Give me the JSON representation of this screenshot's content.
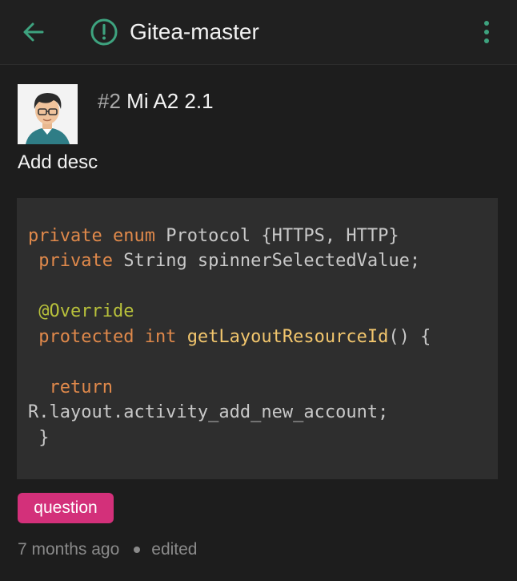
{
  "toolbar": {
    "title": "Gitea-master",
    "back_icon": "arrow-left-icon",
    "status_icon": "alert-circle-icon",
    "menu_icon": "more-vertical-icon",
    "accent_color": "#3ea37f"
  },
  "issue": {
    "number": "#2",
    "title": "Mi A2 2.1",
    "description": "Add desc",
    "avatar_icon": "user-avatar",
    "code_lines": [
      [
        {
          "t": "private enum",
          "c": "kw"
        },
        {
          "t": " Protocol {HTTPS, HTTP}",
          "c": ""
        }
      ],
      [
        {
          "t": " private",
          "c": "kw"
        },
        {
          "t": " String spinnerSelectedValue;",
          "c": ""
        }
      ],
      [
        {
          "t": " @Override",
          "c": "ann"
        }
      ],
      [
        {
          "t": " protected int",
          "c": "kw"
        },
        {
          "t": " ",
          "c": ""
        },
        {
          "t": "getLayoutResourceId",
          "c": "fn"
        },
        {
          "t": "() {",
          "c": ""
        }
      ],
      [
        {
          "t": "  return",
          "c": "kw"
        }
      ],
      [
        {
          "t": "R.layout.activity_add_new_account;",
          "c": ""
        }
      ],
      [
        {
          "t": " }",
          "c": ""
        }
      ]
    ],
    "label": "question",
    "label_color": "#d3307a",
    "time": "7 months ago",
    "edited": "edited"
  }
}
